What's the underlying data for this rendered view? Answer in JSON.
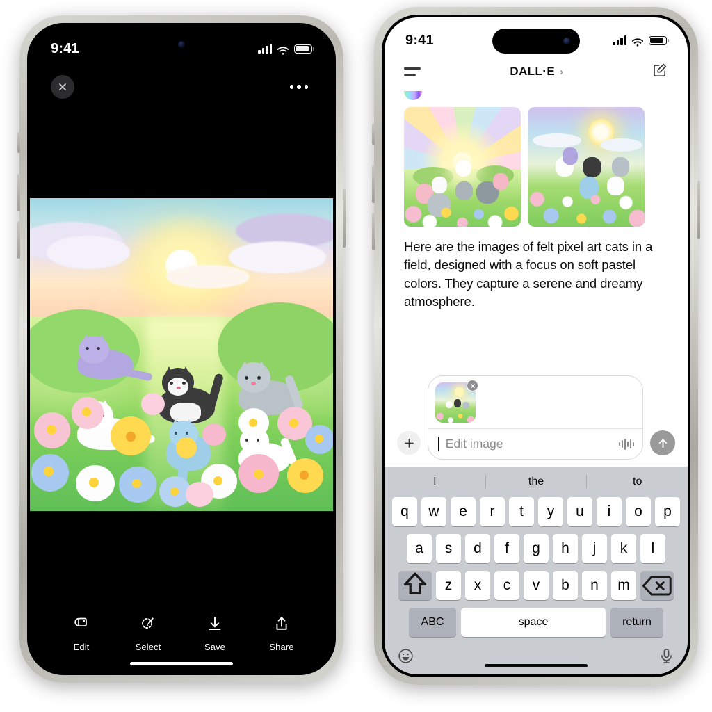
{
  "left_phone": {
    "status_bar": {
      "time": "9:41",
      "signal_icon": "cellular-bars-icon",
      "wifi_icon": "wifi-icon",
      "battery_icon": "battery-icon"
    },
    "viewer": {
      "close_label": "close-icon",
      "more_label": "more-options-icon",
      "image_alt": "felt pixel art cats in a flower field at sunset",
      "toolbar": [
        {
          "label": "Edit",
          "icon": "edit-image-icon"
        },
        {
          "label": "Select",
          "icon": "select-subject-icon"
        },
        {
          "label": "Save",
          "icon": "download-icon"
        },
        {
          "label": "Share",
          "icon": "share-icon"
        }
      ]
    }
  },
  "right_phone": {
    "status_bar": {
      "time": "9:41",
      "signal_icon": "cellular-bars-icon",
      "wifi_icon": "wifi-icon",
      "battery_icon": "battery-icon"
    },
    "nav": {
      "menu_icon": "hamburger-menu-icon",
      "title": "DALL·E",
      "title_chevron": "›",
      "compose_icon": "new-chat-compose-icon"
    },
    "conversation": {
      "assistant_avatar": "dalle-logo-icon",
      "images": [
        {
          "alt": "felt art cats in sunlit field with sunrays"
        },
        {
          "alt": "felt art cats among blue and pink flowers"
        }
      ],
      "message": "Here are the images of felt pixel art cats in a field, designed with a focus on soft pastel colors. They capture a serene and dreamy atmosphere."
    },
    "composer": {
      "plus_icon": "add-attachment-icon",
      "attachment": {
        "thumbnail_alt": "attached generated image",
        "remove_icon": "remove-attachment-icon"
      },
      "input_value": "",
      "input_placeholder": "Edit image",
      "dictation_icon": "voice-waveform-icon",
      "send_icon": "send-arrow-up-icon"
    },
    "keyboard": {
      "predictions": [
        "I",
        "the",
        "to"
      ],
      "row1": [
        "q",
        "w",
        "e",
        "r",
        "t",
        "y",
        "u",
        "i",
        "o",
        "p"
      ],
      "row2": [
        "a",
        "s",
        "d",
        "f",
        "g",
        "h",
        "j",
        "k",
        "l"
      ],
      "row3": [
        "z",
        "x",
        "c",
        "v",
        "b",
        "n",
        "m"
      ],
      "shift_icon": "shift-key-icon",
      "backspace_icon": "backspace-key-icon",
      "abc_label": "ABC",
      "space_label": "space",
      "return_label": "return",
      "emoji_icon": "emoji-key-icon",
      "mic_icon": "dictation-mic-icon"
    }
  },
  "colors": {
    "viewer_background": "#000000",
    "chat_background": "#ffffff",
    "keyboard_background": "#c9ccd1",
    "key_background": "#ffffff",
    "modifier_key_background": "#adb2ba",
    "send_button": "#9a9a9a",
    "placeholder_text": "#8b8b8b"
  }
}
